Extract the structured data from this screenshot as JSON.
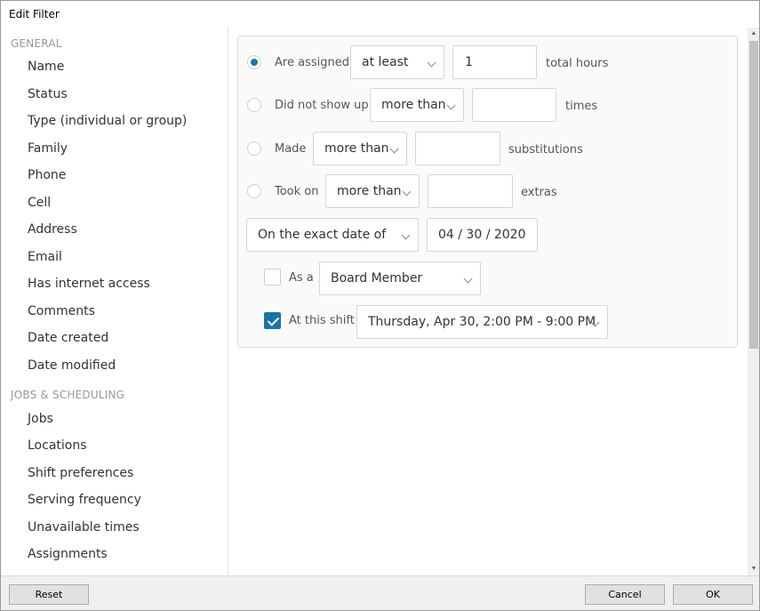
{
  "window": {
    "title": "Edit Filter"
  },
  "sidebar": {
    "sections": [
      {
        "header": "GENERAL",
        "items": [
          "Name",
          "Status",
          "Type (individual or group)",
          "Family",
          "Phone",
          "Cell",
          "Address",
          "Email",
          "Has internet access",
          "Comments",
          "Date created",
          "Date modified"
        ]
      },
      {
        "header": "JOBS & SCHEDULING",
        "items": [
          "Jobs",
          "Locations",
          "Shift preferences",
          "Serving frequency",
          "Unavailable times",
          "Assignments"
        ]
      }
    ]
  },
  "filter": {
    "assigned": {
      "selected": true,
      "label": "Are assigned",
      "operator": "at least",
      "value": "1",
      "unit": "total hours"
    },
    "no_show": {
      "selected": false,
      "label": "Did not show up",
      "operator": "more than",
      "value": "",
      "unit": "times"
    },
    "substitutions": {
      "selected": false,
      "label": "Made",
      "operator": "more than",
      "value": "",
      "unit": "substitutions"
    },
    "extras": {
      "selected": false,
      "label": "Took on",
      "operator": "more than",
      "value": "",
      "unit": "extras"
    },
    "date": {
      "mode": "On the exact date of",
      "value": "04 / 30 / 2020"
    },
    "as_a": {
      "checked": false,
      "label": "As a",
      "value": "Board Member"
    },
    "shift": {
      "checked": true,
      "label": "At this shift",
      "value": "Thursday, Apr 30, 2:00 PM - 9:00 PM"
    }
  },
  "scrollbar": {
    "up_glyph": "▲",
    "down_glyph": "▼"
  },
  "footer": {
    "reset_label": "Reset",
    "cancel_label": "Cancel",
    "ok_label": "OK"
  },
  "colors": {
    "accent": "#1a74a8",
    "panel_bg": "#fafafa",
    "footer_bg": "#f0f0f0"
  }
}
